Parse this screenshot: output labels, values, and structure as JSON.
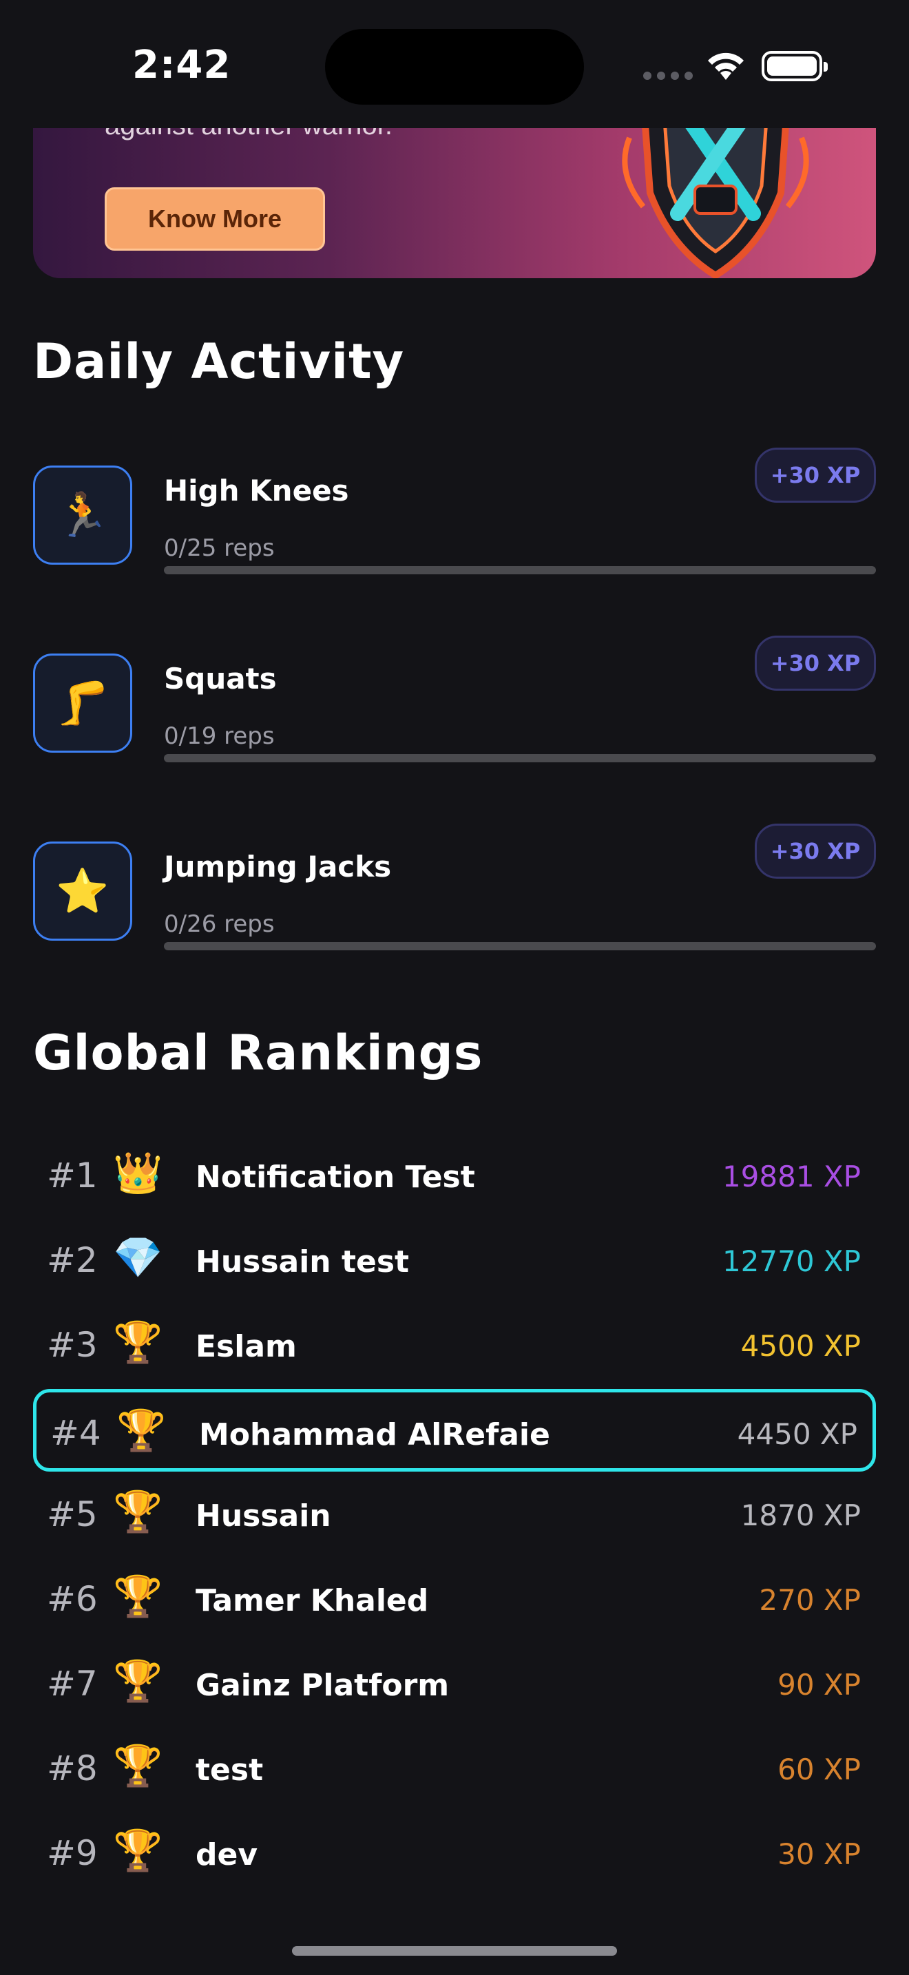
{
  "status_bar": {
    "time": "2:42"
  },
  "promo": {
    "text": "against another warrior.",
    "button_label": "Know More"
  },
  "daily_activity": {
    "title": "Daily Activity",
    "items": [
      {
        "name": "High Knees",
        "reps": "0/25 reps",
        "xp": "+30 XP",
        "icon": "🏃",
        "progress": 0
      },
      {
        "name": "Squats",
        "reps": "0/19 reps",
        "xp": "+30 XP",
        "icon": "🦵",
        "progress": 0
      },
      {
        "name": "Jumping Jacks",
        "reps": "0/26 reps",
        "xp": "+30 XP",
        "icon": "⭐",
        "progress": 0
      }
    ]
  },
  "rankings": {
    "title": "Global Rankings",
    "rows": [
      {
        "rank": "#1",
        "icon": "👑",
        "name": "Notification Test",
        "xp": "19881 XP",
        "color": "#a94ee3"
      },
      {
        "rank": "#2",
        "icon": "💎",
        "name": "Hussain test",
        "xp": "12770 XP",
        "color": "#2ec8d6"
      },
      {
        "rank": "#3",
        "icon": "🏆",
        "name": "Eslam",
        "xp": "4500 XP",
        "color": "#f2c230"
      },
      {
        "rank": "#4",
        "icon": "🏆",
        "name": "Mohammad AlRefaie",
        "xp": "4450 XP",
        "color": "#b8b8be"
      },
      {
        "rank": "#5",
        "icon": "🏆",
        "name": "Hussain",
        "xp": "1870 XP",
        "color": "#b8b8be"
      },
      {
        "rank": "#6",
        "icon": "🏆",
        "name": "Tamer Khaled",
        "xp": "270 XP",
        "color": "#d8832e"
      },
      {
        "rank": "#7",
        "icon": "🏆",
        "name": "Gainz Platform",
        "xp": "90 XP",
        "color": "#d8832e"
      },
      {
        "rank": "#8",
        "icon": "🏆",
        "name": "test",
        "xp": "60 XP",
        "color": "#d8832e"
      },
      {
        "rank": "#9",
        "icon": "🏆",
        "name": "dev",
        "xp": "30 XP",
        "color": "#d8832e"
      }
    ]
  },
  "colors": {
    "background": "#131317",
    "accent_blue": "#3d7ff2",
    "xp_badge": "#7b7bee",
    "current_user_border": "#2ee6ea"
  }
}
